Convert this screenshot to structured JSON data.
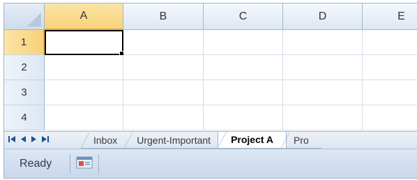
{
  "columns": [
    "A",
    "B",
    "C",
    "D",
    "E"
  ],
  "rows": [
    "1",
    "2",
    "3",
    "4"
  ],
  "active_cell": "A1",
  "sheet_nav": {
    "first": "first-sheet",
    "prev": "previous-sheet",
    "next": "next-sheet",
    "last": "last-sheet"
  },
  "sheet_tabs": [
    "Inbox",
    "Urgent-Important",
    "Project A",
    "Pro"
  ],
  "active_sheet": "Project A",
  "status": {
    "mode_text": "Ready",
    "macro_icon": "record-macro-icon"
  },
  "colors": {
    "selected_header": "#f8d27a",
    "header_border": "#9eb6ce",
    "status_bar": "#c8d7eb"
  }
}
